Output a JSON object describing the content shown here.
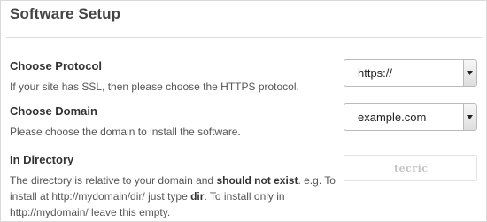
{
  "header": {
    "title": "Software Setup"
  },
  "protocol": {
    "label": "Choose Protocol",
    "description": "If your site has SSL, then please choose the HTTPS protocol.",
    "selected": "https://"
  },
  "domain": {
    "label": "Choose Domain",
    "description": "Please choose the domain to install the software.",
    "selected": "example.com"
  },
  "directory": {
    "label": "In Directory",
    "description_part1": "The directory is relative to your domain and ",
    "description_bold1": "should not exist",
    "description_part2": ". e.g. To install at http://mydomain/dir/ just type ",
    "description_bold2": "dir",
    "description_part3": ". To install only in http://mydomain/ leave this empty.",
    "value": "",
    "watermark": "tecric"
  },
  "colors": {
    "border": "#d9d9d9",
    "text": "#333333",
    "muted": "#555555"
  },
  "icons": {
    "select_arrow": "caret-down-icon"
  }
}
